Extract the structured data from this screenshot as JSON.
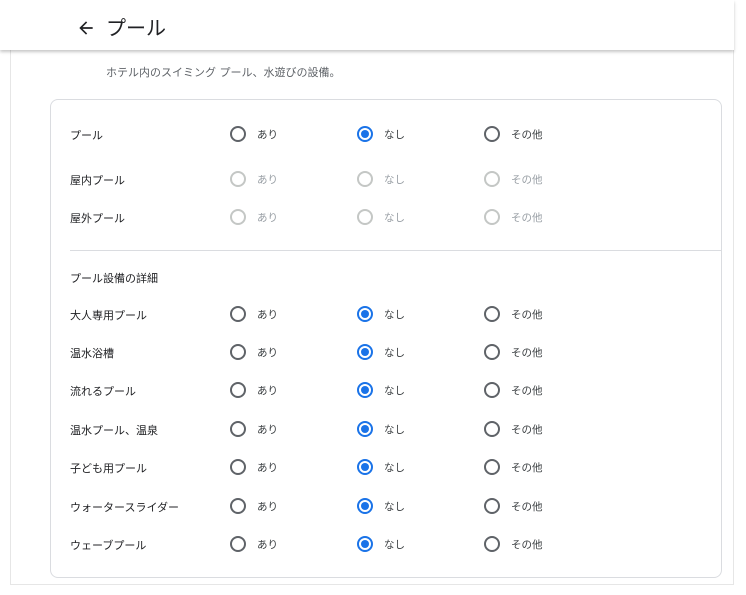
{
  "header": {
    "title": "プール"
  },
  "subtitle": "ホテル内のスイミング プール、水遊びの設備。",
  "section_heading": "プール設備の詳細",
  "options": [
    "あり",
    "なし",
    "その他"
  ],
  "rows": [
    {
      "label": "プール",
      "selected": 1,
      "disabled": false
    },
    {
      "label": "屋内プール",
      "selected": -1,
      "disabled": true
    },
    {
      "label": "屋外プール",
      "selected": -1,
      "disabled": true
    },
    {
      "label": "大人専用プール",
      "selected": 1,
      "disabled": false
    },
    {
      "label": "温水浴槽",
      "selected": 1,
      "disabled": false
    },
    {
      "label": "流れるプール",
      "selected": 1,
      "disabled": false
    },
    {
      "label": "温水プール、温泉",
      "selected": 1,
      "disabled": false
    },
    {
      "label": "子ども用プール",
      "selected": 1,
      "disabled": false
    },
    {
      "label": "ウォータースライダー",
      "selected": 1,
      "disabled": false
    },
    {
      "label": "ウェーブプール",
      "selected": 1,
      "disabled": false
    }
  ],
  "colors": {
    "accent": "#1a73e8",
    "radio_unchecked": "#5f6368",
    "radio_disabled": "#c4c7c5"
  }
}
